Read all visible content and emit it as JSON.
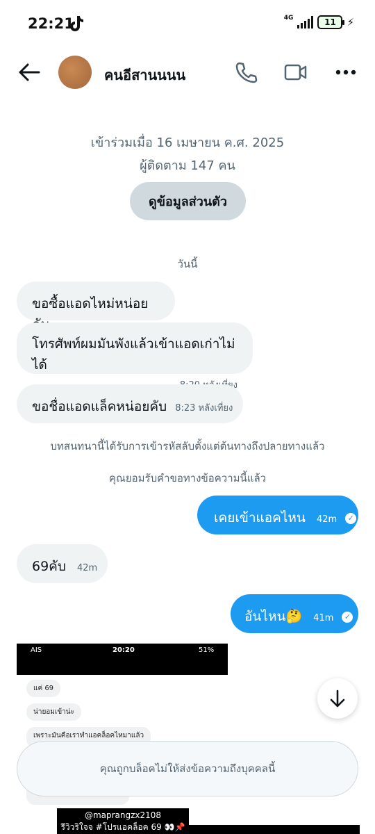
{
  "status_bar": {
    "time": "22:21",
    "network": "4G",
    "battery": "11"
  },
  "header": {
    "title": "คนอีสานนนน"
  },
  "info": {
    "joined": "เข้าร่วมเมื่อ 16 เมษายน ค.ศ. 2025",
    "followers": "ผู้ติดตาม 147 คน",
    "profile_button": "ดูข้อมูลส่วนตัว"
  },
  "date_separator": "วันนี้",
  "messages": [
    {
      "text": "ขอซื้อแอดไหม่หน่อยคับ"
    },
    {
      "text": "โทรศัพท์ผมมันพังแล้วเข้าแอดเก่าไม่ได้",
      "time": "8:20 หลังเที่ยง"
    },
    {
      "text": "ขอชื่อแอดแล็คหน่อยคับ",
      "time": "8:23 หลังเที่ยง"
    },
    {
      "text": "เคยเข้าแอคไหน",
      "time": "42m"
    },
    {
      "text": "69คับ",
      "time": "42m"
    },
    {
      "text": "อันไหน🤔",
      "time": "41m"
    }
  ],
  "system_messages": [
    "บทสนทนานี้ได้รับการเข้ารหัสลับตั้งแต่ต้นทางถึงปลายทางแล้ว",
    "คุณยอมรับคำขอทางข้อความนี้แล้ว"
  ],
  "image_message": {
    "carrier": "AIS",
    "time": "20:20",
    "battery": "51%",
    "bubbles": [
      "แค่ 69",
      "น่ายอมเข้าน่ะ",
      "เพราะมันคือเราทำแอคล็อคไหมาแล้ว"
    ]
  },
  "blocked_notice": "คุณถูกบล็อคไม่ให้ส่งข้อความถึงบุคคลนี้",
  "watermark": {
    "handle": "@maprangzx2108",
    "caption": "รีวิวริใจจ #โปรแอคล็อค 69 👀📌"
  },
  "colors": {
    "accent": "#1d9bf0",
    "incoming_bubble": "#eff3f4",
    "secondary_text": "#536471"
  }
}
